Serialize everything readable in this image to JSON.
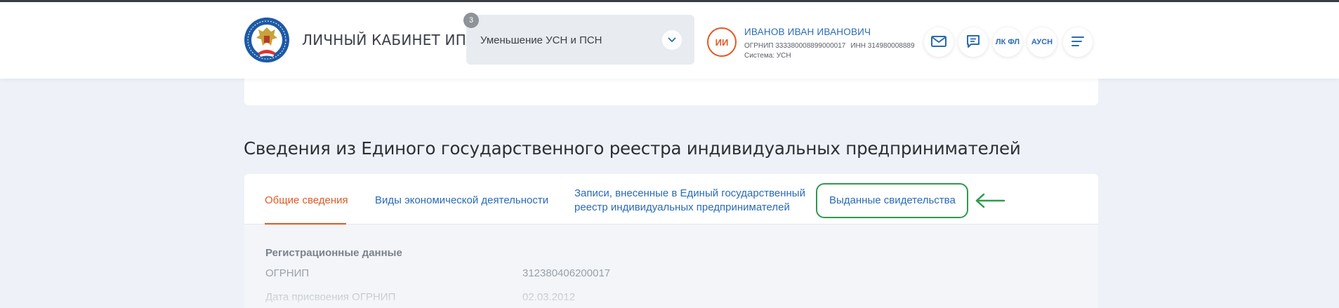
{
  "header": {
    "brand": "ЛИЧНЫЙ КАБИНЕТ ИП",
    "selector": {
      "badge": "3",
      "value": "Уменьшение УСН и ПСН"
    },
    "user": {
      "initials": "ИИ",
      "name": "ИВАНОВ ИВАН ИВАНОВИЧ",
      "ogrnip": "ОГРНИП 333380008899000017",
      "inn": "ИНН 314980008889",
      "system": "Система: УСН"
    },
    "buttons": [
      {
        "icon": "mail-icon"
      },
      {
        "icon": "chat-icon"
      },
      {
        "label": "ЛК ФЛ"
      },
      {
        "label": "АУСН"
      },
      {
        "icon": "menu-icon"
      }
    ]
  },
  "section": {
    "title": "Сведения из Единого государственного реестра индивидуальных предпринимателей",
    "tabs": [
      {
        "label": "Общие сведения",
        "active": true
      },
      {
        "label": "Виды экономической деятельности"
      },
      {
        "label_line1": "Записи, внесенные в Единый государственный",
        "label_line2": "реестр индивидуальных предпринимателей"
      },
      {
        "label": "Выданные свидетельства",
        "highlighted": true
      }
    ]
  },
  "details": {
    "heading": "Регистрационные данные",
    "rows": [
      {
        "label": "ОГРНИП",
        "value": "312380406200017"
      },
      {
        "label": "Дата присвоения ОГРНИП",
        "value": "02.03.2012"
      }
    ]
  },
  "colors": {
    "accent_orange": "#e05a24",
    "link_blue": "#2a6bb5",
    "highlight_green": "#2f9a4d"
  }
}
